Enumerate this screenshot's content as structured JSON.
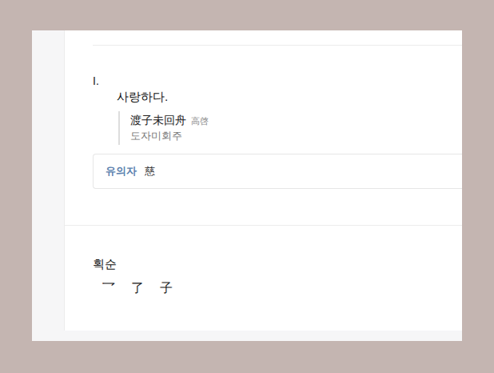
{
  "definition": {
    "number": "I.",
    "meaning": "사랑하다.",
    "example": {
      "text": "渡子未回舟",
      "source": "高啓",
      "reading": "도자미회주"
    }
  },
  "related": {
    "label": "유의자",
    "chars": "慈"
  },
  "stroke_order": {
    "title": "획순",
    "strokes": [
      "乛",
      "了",
      "子"
    ]
  }
}
